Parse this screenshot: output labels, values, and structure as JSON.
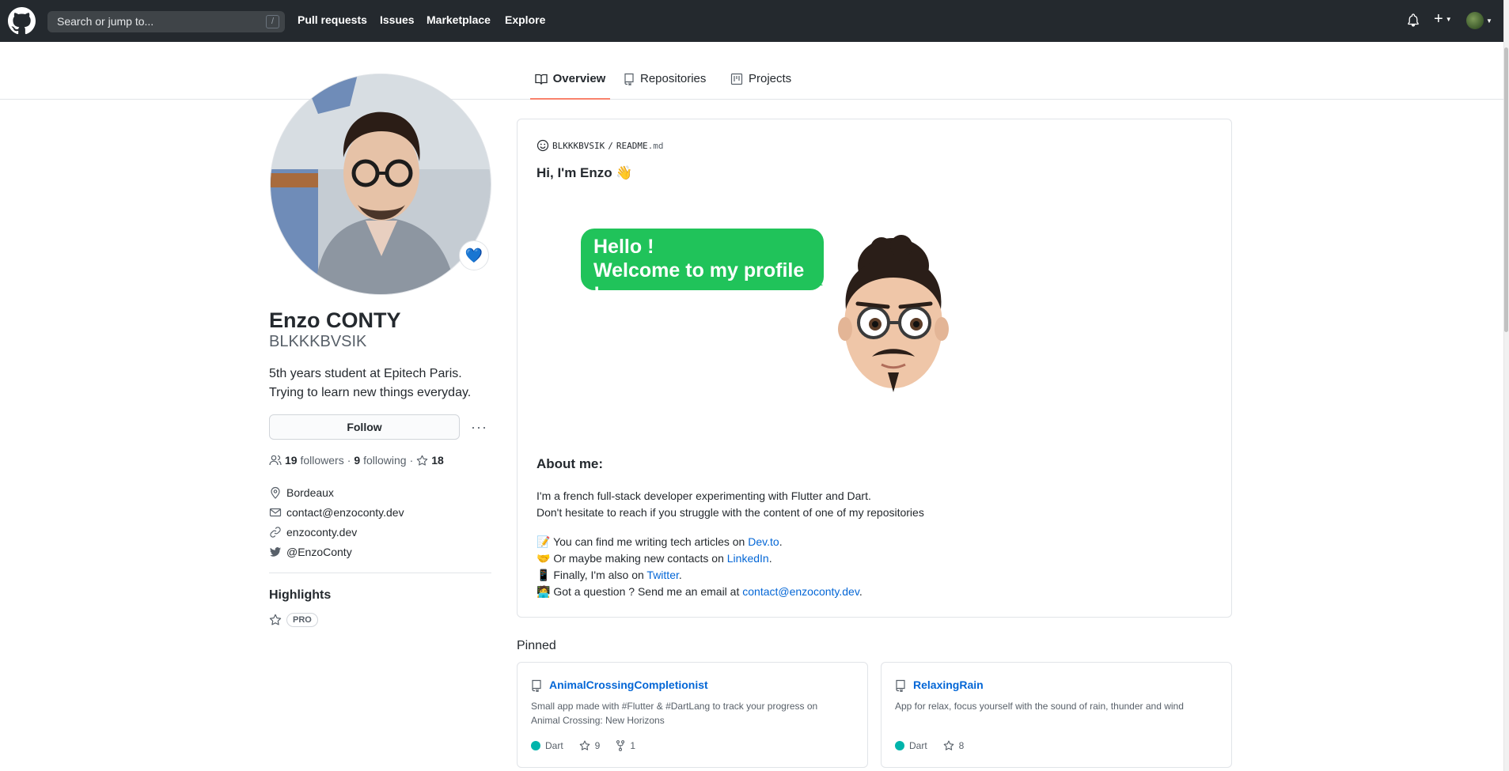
{
  "header": {
    "search_placeholder": "Search or jump to...",
    "search_shortcut": "/",
    "nav": [
      "Pull requests",
      "Issues",
      "Marketplace",
      "Explore"
    ]
  },
  "tabs": [
    {
      "label": "Overview",
      "icon": "book-icon"
    },
    {
      "label": "Repositories",
      "icon": "repo-icon"
    },
    {
      "label": "Projects",
      "icon": "project-icon"
    }
  ],
  "profile": {
    "fullname": "Enzo CONTY",
    "login": "BLKKKBVSIK",
    "status_emoji": "💙",
    "bio_line1": "5th years student at Epitech Paris.",
    "bio_line2": "Trying to learn new things everyday.",
    "follow_label": "Follow",
    "followers_count": "19",
    "followers_label": "followers",
    "following_count": "9",
    "following_label": "following",
    "stars_count": "18",
    "location": "Bordeaux",
    "email": "contact@enzoconty.dev",
    "website": "enzoconty.dev",
    "twitter": "@EnzoConty",
    "highlights_title": "Highlights",
    "pro_badge": "PRO"
  },
  "readme": {
    "path_user": "BLKKKBVSIK",
    "path_sep": "/",
    "path_file": "README",
    "path_ext": ".md",
    "greeting": "Hi, I'm Enzo 👋",
    "bubble_line1": "Hello !",
    "bubble_line2": "Welcome to my profile !",
    "about_title": "About me:",
    "about_line1": "I'm a french full-stack developer experimenting with Flutter and Dart.",
    "about_line2": "Don't hesitate to reach if you struggle with the content of one of my repositories",
    "line_articles_prefix": "📝 You can find me writing tech articles on ",
    "line_articles_link": "Dev.to",
    "line_contacts_prefix": "🤝 Or maybe making new contacts on ",
    "line_contacts_link": "LinkedIn",
    "line_twitter_prefix": "📱 Finally, I'm also on ",
    "line_twitter_link": "Twitter",
    "line_email_prefix": "🧑‍💻 Got a question ? Send me an email at ",
    "line_email_link": "contact@enzoconty.dev",
    "period": "."
  },
  "pinned": {
    "title": "Pinned",
    "repos": [
      {
        "name": "AnimalCrossingCompletionist",
        "description_line1": "Small app made with #Flutter & #DartLang to track your progress on",
        "description_line2": "Animal Crossing: New Horizons",
        "language": "Dart",
        "stars": "9",
        "forks": "1"
      },
      {
        "name": "RelaxingRain",
        "description_line1": "App for relax, focus yourself with the sound of rain, thunder and wind",
        "description_line2": "",
        "language": "Dart",
        "stars": "8"
      }
    ]
  },
  "colors": {
    "header_bg": "#24292e",
    "link": "#0366d6",
    "tab_underline": "#f9826c",
    "bubble": "#20c35a",
    "dart": "#00b4ab"
  }
}
